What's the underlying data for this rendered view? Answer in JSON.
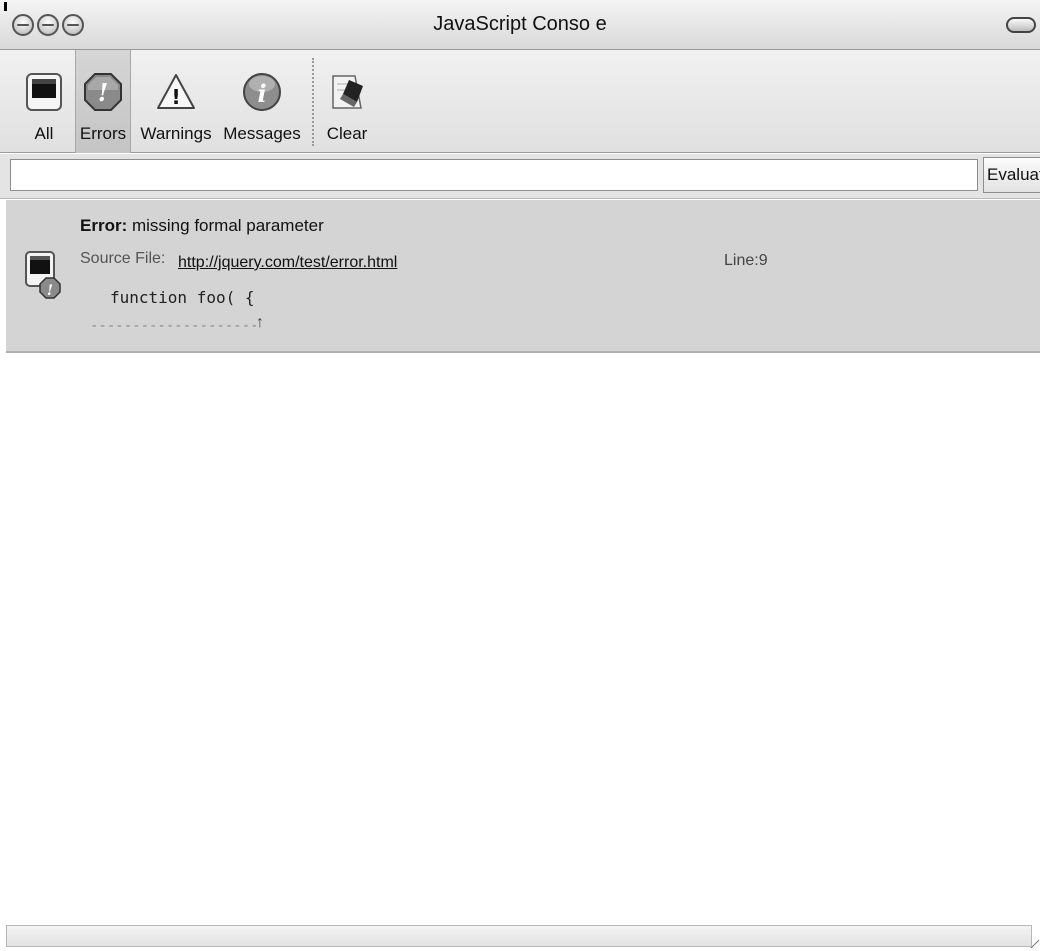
{
  "window": {
    "title": "JavaScript Conso e"
  },
  "toolbar": {
    "items": [
      {
        "label": "All",
        "icon": "all-console-icon"
      },
      {
        "label": "Errors",
        "icon": "error-octagon-icon",
        "selected": true
      },
      {
        "label": "Warnings",
        "icon": "warning-triangle-icon"
      },
      {
        "label": "Messages",
        "icon": "info-circle-icon"
      },
      {
        "label": "Clear",
        "icon": "eraser-icon"
      }
    ]
  },
  "evaluate": {
    "value": "",
    "button_label": "Evaluat"
  },
  "log": {
    "entries": [
      {
        "type_label": "Error:",
        "message": "missing formal parameter",
        "source_label": "Source File:",
        "source_url": "http://jquery.com/test/error.html",
        "line_label": "Line:9",
        "code": "function foo( {",
        "pointer": "--------------------",
        "pointer_arrow": "↑"
      }
    ]
  },
  "colors": {
    "selected_entry_bg": "#d4d4d4",
    "toolbar_bg": "#e6e6e6",
    "link": "#111111"
  }
}
